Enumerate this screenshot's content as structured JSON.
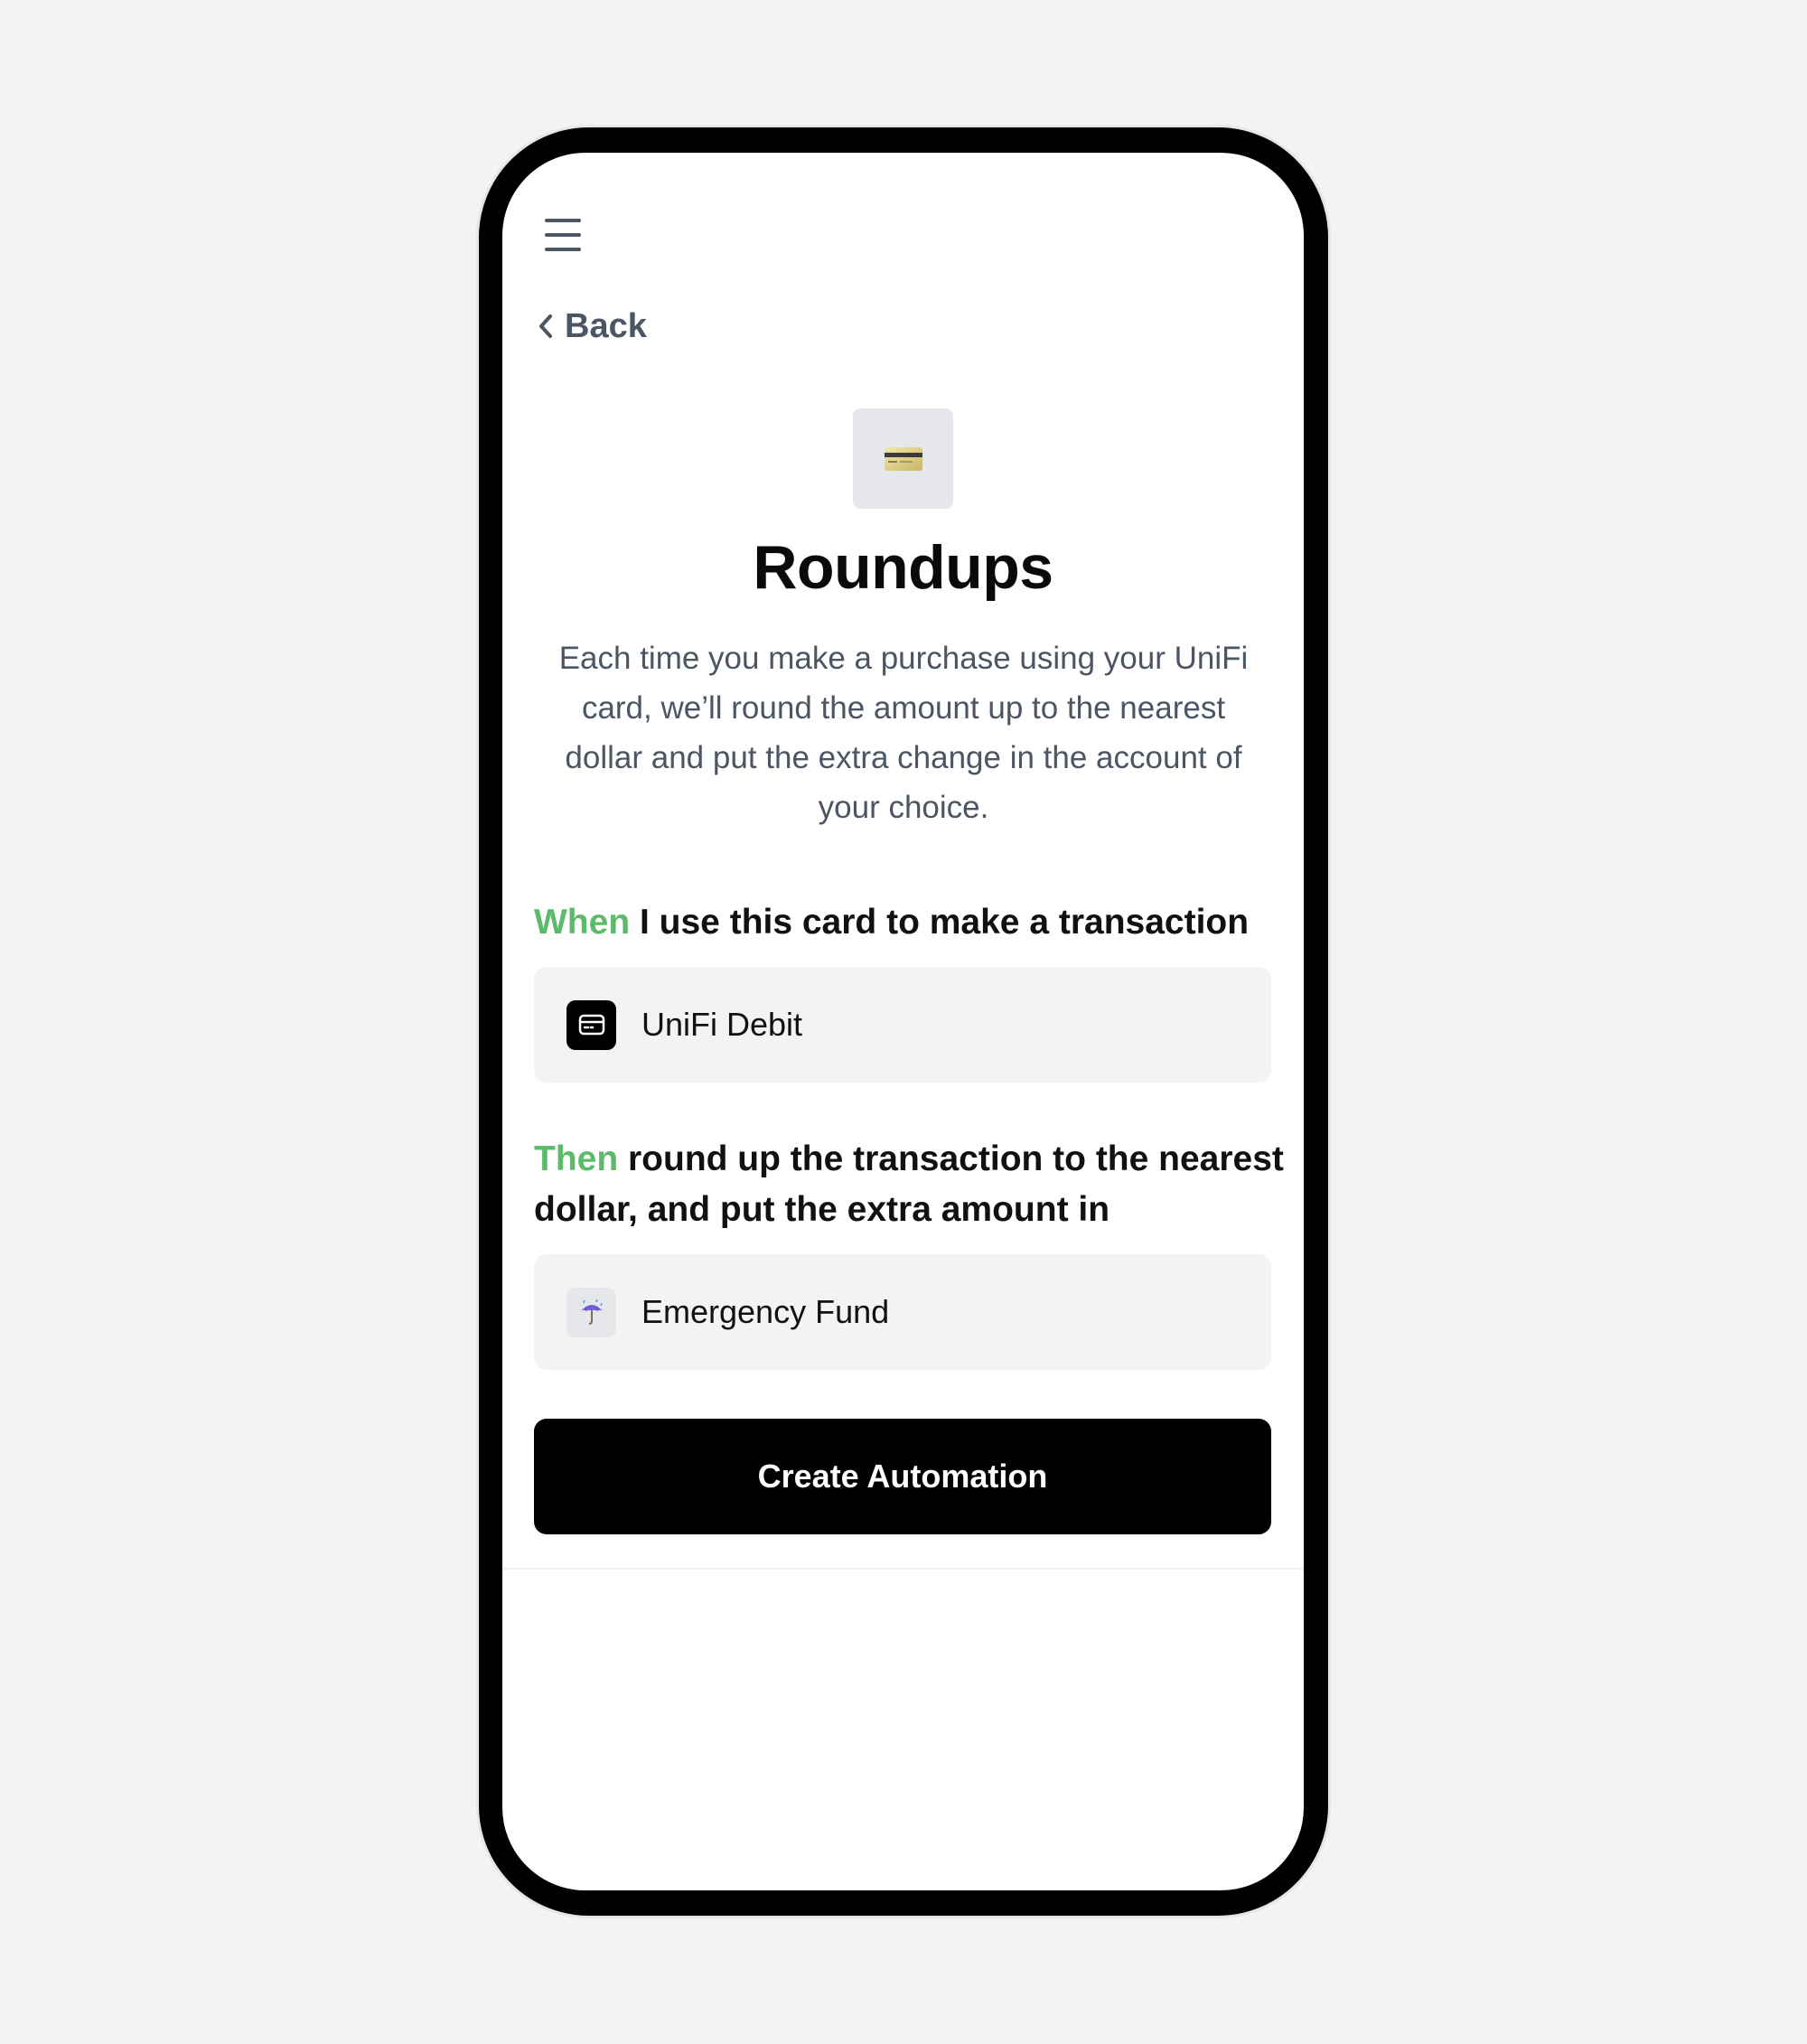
{
  "header": {
    "menu_icon": "hamburger-menu-icon",
    "back_label": "Back",
    "back_icon": "chevron-left-icon"
  },
  "hero": {
    "icon": "credit-card-icon",
    "title": "Roundups",
    "description": "Each time you make a purchase using your UniFi card, we’ll round the amount up to the nearest dollar and put the extra change in the account of your choice."
  },
  "when_rule": {
    "keyword": "When",
    "text": " I use this card to make a transaction",
    "selection": {
      "icon": "card-icon",
      "label": "UniFi Debit"
    }
  },
  "then_rule": {
    "keyword": "Then",
    "text": " round up the transaction to the nearest dollar, and put the extra amount in",
    "selection": {
      "icon": "umbrella-icon",
      "label": "Emergency Fund"
    }
  },
  "actions": {
    "create_label": "Create Automation"
  },
  "colors": {
    "accent_green": "#5cba6a",
    "button_bg": "#000000",
    "box_bg": "#f3f3f3",
    "muted_text": "#4b5563"
  }
}
